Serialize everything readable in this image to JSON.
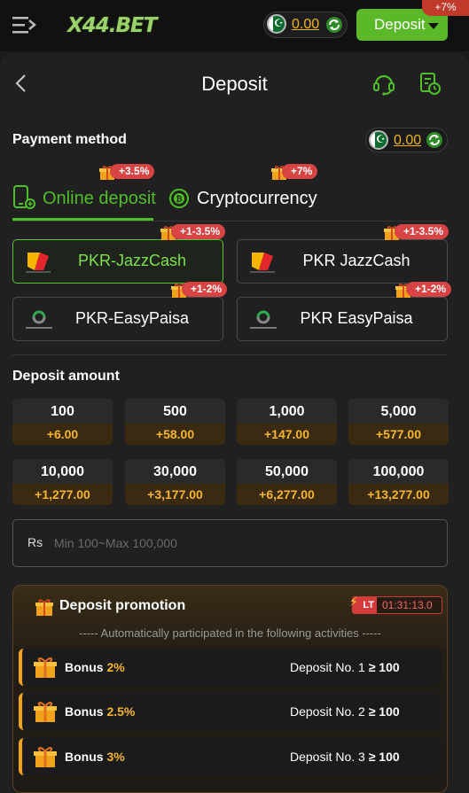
{
  "topbar": {
    "logo_text": "X44.BET",
    "balance": "0.00",
    "deposit_label": "Deposit",
    "corner_badge": "+7%"
  },
  "panel": {
    "title": "Deposit"
  },
  "payment_method": {
    "title": "Payment method",
    "balance": "0.00"
  },
  "tabs": [
    {
      "label": "Online deposit",
      "badge": "+3.5%",
      "active": true
    },
    {
      "label": "Cryptocurrency",
      "badge": "+7%",
      "active": false
    }
  ],
  "channels": [
    {
      "label": "PKR-JazzCash",
      "badge": "+1-3.5%",
      "logo": "jazzcash-logo",
      "selected": true
    },
    {
      "label": "PKR JazzCash",
      "badge": "+1-3.5%",
      "logo": "jazzcash-logo",
      "selected": false
    },
    {
      "label": "PKR-EasyPaisa",
      "badge": "+1-2%",
      "logo": "easypaisa-logo",
      "selected": false
    },
    {
      "label": "PKR EasyPaisa",
      "badge": "+1-2%",
      "logo": "easypaisa-logo",
      "selected": false
    }
  ],
  "deposit_amount": {
    "title": "Deposit amount",
    "options": [
      {
        "amount": "100",
        "bonus": "+6.00"
      },
      {
        "amount": "500",
        "bonus": "+58.00"
      },
      {
        "amount": "1,000",
        "bonus": "+147.00"
      },
      {
        "amount": "5,000",
        "bonus": "+577.00"
      },
      {
        "amount": "10,000",
        "bonus": "+1,277.00"
      },
      {
        "amount": "30,000",
        "bonus": "+3,177.00"
      },
      {
        "amount": "50,000",
        "bonus": "+6,277.00"
      },
      {
        "amount": "100,000",
        "bonus": "+13,277.00"
      }
    ],
    "currency_symbol": "Rs",
    "input_value": "",
    "input_placeholder": "Min 100~Max 100,000"
  },
  "promotion": {
    "title": "Deposit promotion",
    "lt_tag": "LT",
    "timer": "01:31:13.0",
    "subtitle": "----- Automatically participated in the following activities -----",
    "rows": [
      {
        "bonus_label": "Bonus",
        "bonus_pct": "2%",
        "deposit_label": "Deposit No. 1",
        "cond": "≥ 100"
      },
      {
        "bonus_label": "Bonus",
        "bonus_pct": "2.5%",
        "deposit_label": "Deposit No. 2",
        "cond": "≥ 100"
      },
      {
        "bonus_label": "Bonus",
        "bonus_pct": "3%",
        "deposit_label": "Deposit No. 3",
        "cond": "≥ 100"
      }
    ]
  },
  "colors": {
    "accent_green": "#5bb829",
    "gold": "#f5b52a",
    "badge_red": "#d84343"
  }
}
